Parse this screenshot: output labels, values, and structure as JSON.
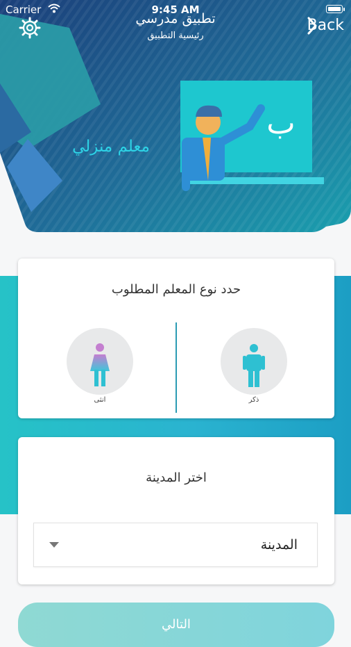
{
  "status_bar": {
    "carrier": "Carrier",
    "time": "9:45 AM"
  },
  "nav": {
    "title": "تطبيق مدرسي",
    "subtitle": "رئيسية التطبيق",
    "back_label": "Back",
    "settings_icon": "gear-icon",
    "back_icon": "chevron-right-icon"
  },
  "hero": {
    "caption": "معلم منزلي",
    "board_letter": "ب",
    "colors": {
      "dark_blue": "#1f3b77",
      "teal": "#2aa6ac",
      "board": "#1ec7cf",
      "accent": "#2dd3e6"
    }
  },
  "gender_card": {
    "title": "حدد نوع المعلم المطلوب",
    "options": [
      {
        "label": "ذكر",
        "icon": "male-icon"
      },
      {
        "label": "انثى",
        "icon": "female-icon"
      }
    ]
  },
  "city_card": {
    "title": "اختر المدينة",
    "select_value": "المدينة",
    "select_icon": "dropdown-caret-icon"
  },
  "continue_button": {
    "label": "التالي"
  }
}
